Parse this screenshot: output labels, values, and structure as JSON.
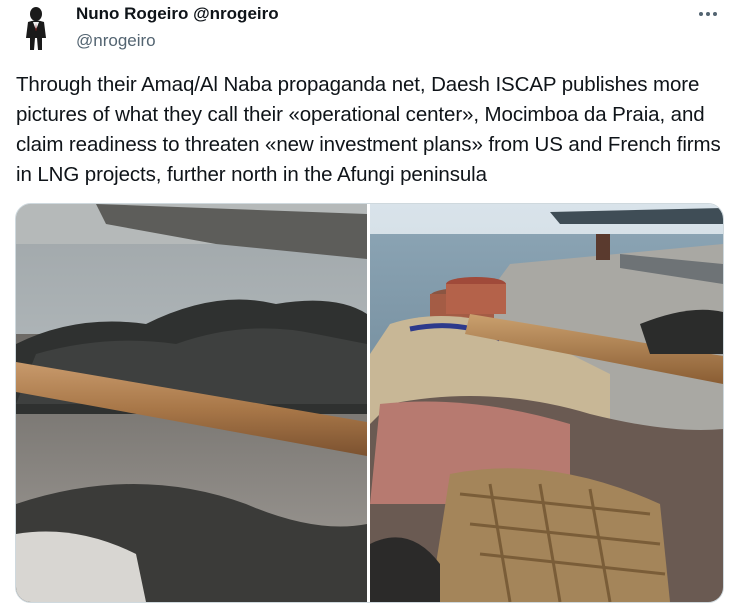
{
  "author": {
    "display_name": "Nuno Rogeiro @nrogeiro",
    "handle": "@nrogeiro",
    "avatar_icon": "person-avatar"
  },
  "more_icon": "more-horizontal-icon",
  "tweet": {
    "text": "Through their Amaq/Al Naba propaganda net, Daesh ISCAP publishes more pictures of what they call their «operational center», Mocimboa da Praia, and claim readiness to threaten «new investment plans» from US and French firms in LNG projects, further north in the Afungi peninsula"
  },
  "media": {
    "count": 2,
    "photos": [
      {
        "description_icon": "photo-icon"
      },
      {
        "description_icon": "photo-icon"
      }
    ]
  },
  "colors": {
    "text": "#0f1419",
    "secondary_text": "#536471",
    "border": "#cfd9de"
  }
}
